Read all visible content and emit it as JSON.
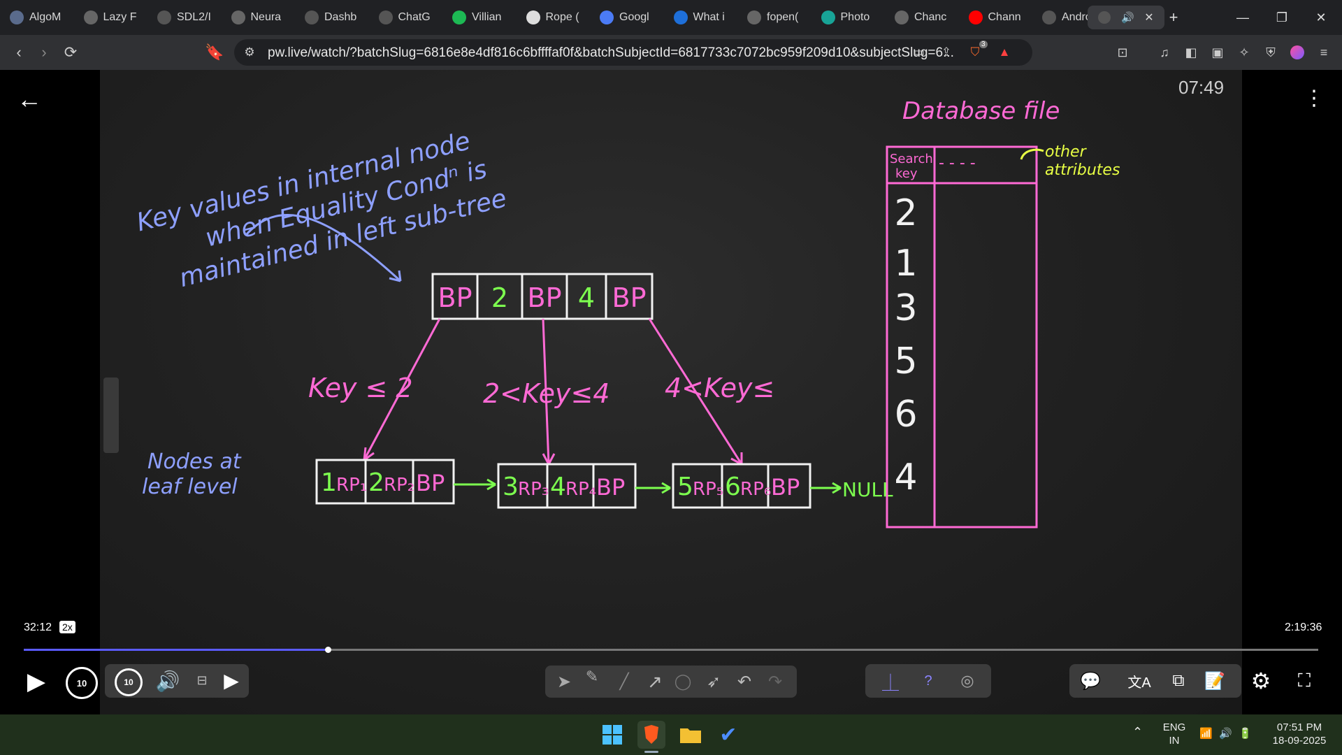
{
  "colors": {
    "chrome_bg": "#202124",
    "toolbar_bg": "#303134",
    "board_pink": "#ff6ad5",
    "board_blue": "#8ea0ff",
    "board_green": "#7dff4f",
    "board_yellow": "#e8ff44",
    "progress": "#5b5bff",
    "taskbar_bg": "#20301c"
  },
  "browser": {
    "tabs": [
      {
        "label": "AlgoM",
        "icon": "algomaster-icon",
        "color": "#5a6b8c"
      },
      {
        "label": "Lazy F",
        "icon": "globe-icon",
        "color": "#666"
      },
      {
        "label": "SDL2/I",
        "icon": "github-icon",
        "color": "#555"
      },
      {
        "label": "Neura",
        "icon": "globe-icon",
        "color": "#666"
      },
      {
        "label": "Dashb",
        "icon": "github-icon",
        "color": "#555"
      },
      {
        "label": "ChatG",
        "icon": "openai-icon",
        "color": "#555"
      },
      {
        "label": "Villian",
        "icon": "spotify-icon",
        "color": "#1db954"
      },
      {
        "label": "Rope (",
        "icon": "wikipedia-icon",
        "color": "#ddd"
      },
      {
        "label": "Googl",
        "icon": "gemini-icon",
        "color": "#4b7bf5"
      },
      {
        "label": "What i",
        "icon": "orm-icon",
        "color": "#1e6fd9"
      },
      {
        "label": "fopen(",
        "icon": "globe-icon",
        "color": "#666"
      },
      {
        "label": "Photo",
        "icon": "photopea-icon",
        "color": "#18a497"
      },
      {
        "label": "Chanc",
        "icon": "globe-icon",
        "color": "#666"
      },
      {
        "label": "Chann",
        "icon": "youtube-icon",
        "color": "#ff0000"
      },
      {
        "label": "Andro",
        "icon": "openai-icon",
        "color": "#555"
      }
    ],
    "active_tab_icons": [
      "pw-icon",
      "speaker-icon",
      "close-icon"
    ],
    "url": "pw.live/watch/?batchSlug=6816e8e4df816c6bffffaf0f&batchSubjectId=6817733c7072bc959f209d10&subjectSlug=6...",
    "shield_badge": "3"
  },
  "player": {
    "clock": "07:49",
    "elapsed": "32:12",
    "speed": "2x",
    "duration": "2:19:36",
    "progress": 0.235
  },
  "board": {
    "title_lines": [
      "Key values in internal node",
      "when Equality Condⁿ is",
      "maintained in left sub-tree"
    ],
    "root_cells": [
      "BP",
      "2",
      "BP",
      "4",
      "BP"
    ],
    "conditions": [
      "Key ≤ 2",
      "2<Key≤4",
      "4<Key≤"
    ],
    "leaf_label": [
      "Nodes at",
      "leaf level"
    ],
    "leaves": [
      [
        {
          "k": "1",
          "rp": "RP₁"
        },
        {
          "k": "2",
          "rp": "RP₂"
        },
        {
          "bp": "BP"
        }
      ],
      [
        {
          "k": "3",
          "rp": "RP₃"
        },
        {
          "k": "4",
          "rp": "RP₄"
        },
        {
          "bp": "BP"
        }
      ],
      [
        {
          "k": "5",
          "rp": "RP₅"
        },
        {
          "k": "6",
          "rp": "RP₆"
        },
        {
          "bp": "BP"
        }
      ]
    ],
    "null_label": "NULL",
    "db_title": "Database file",
    "db_header_col1": [
      "Search",
      "key"
    ],
    "db_header_col2": "- - - -",
    "db_note": [
      "other",
      "attributes"
    ],
    "db_keys": [
      "2",
      "1",
      "3",
      "5",
      "6",
      "4"
    ]
  },
  "taskbar": {
    "lang_top": "ENG",
    "lang_bottom": "IN",
    "time": "07:51 PM",
    "date": "18-09-2025"
  }
}
